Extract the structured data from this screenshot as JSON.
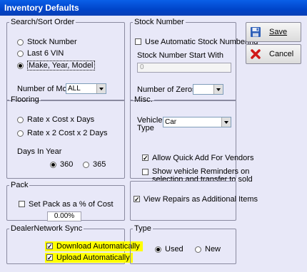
{
  "window": {
    "title": "Inventory Defaults"
  },
  "search_sort": {
    "legend": "Search/Sort Order",
    "options": [
      "Stock Number",
      "Last 6 VIN",
      "Make, Year, Model"
    ],
    "selected": "Make, Year, Model",
    "months_label": "Number of Months",
    "months_value": "ALL"
  },
  "stock_number": {
    "legend": "Stock Number",
    "auto_label": "Use Automatic Stock Numbering",
    "start_label": "Stock Number Start With",
    "start_value": "0",
    "zeros_label": "Number of Zeros",
    "zeros_value": ""
  },
  "buttons": {
    "save": "Save",
    "cancel": "Cancel"
  },
  "flooring": {
    "legend": "Flooring",
    "options": [
      "Rate x Cost x Days",
      "Rate x 2 Cost x 2 Days"
    ],
    "days_label": "Days In Year",
    "days_options": [
      "360",
      "365"
    ],
    "days_selected": "360"
  },
  "misc": {
    "legend": "Misc.",
    "vehicle_type_label": "Vehicle Type",
    "vehicle_type_value": "Car",
    "quick_add_label": "Allow Quick Add For Vendors",
    "quick_add_checked": true,
    "reminders_label_1": "Show vehicle Reminders on",
    "reminders_label_2": "selection and transfer to sold",
    "reminders_checked": false
  },
  "pack": {
    "legend": "Pack",
    "set_pack_label": "Set Pack as a % of Cost",
    "set_pack_checked": false,
    "pack_value": "0.00%"
  },
  "repairs": {
    "label": "View Repairs as Additional Items",
    "checked": true
  },
  "dealer_sync": {
    "legend": "DealerNetwork Sync",
    "download_label": "Download Automatically",
    "upload_label": "Upload  Automatically",
    "download_checked": true,
    "upload_checked": true,
    "highlight_color": "#ffff00"
  },
  "type": {
    "legend": "Type",
    "options": [
      "Used",
      "New"
    ],
    "selected": "Used"
  },
  "icons": {
    "save": "floppy-disk-icon",
    "cancel": "red-x-icon"
  }
}
